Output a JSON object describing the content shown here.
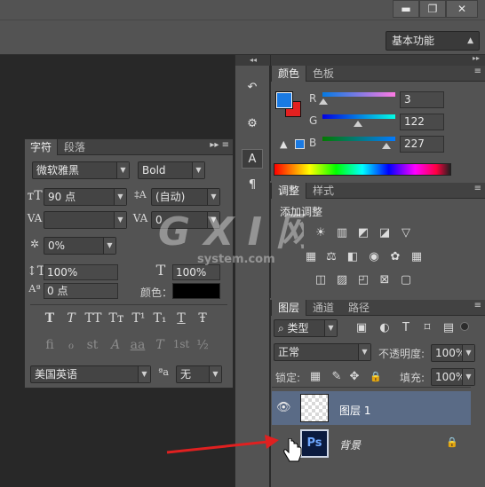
{
  "window": {
    "controls": [
      "minimize-icon",
      "restore-icon",
      "close-icon"
    ],
    "minimize_glyph": "▬",
    "restore_glyph": "❐",
    "close_glyph": "✕"
  },
  "options_bar": {
    "workspace": "基本功能"
  },
  "character_panel": {
    "tabs": [
      "字符",
      "段落"
    ],
    "font_family": "微软雅黑",
    "font_style": "Bold",
    "font_size": "90 点",
    "leading": "(自动)",
    "kerning": "",
    "tracking": "0",
    "tsume": "0%",
    "vertical_scale": "100%",
    "horizontal_scale": "100%",
    "baseline_shift": "0 点",
    "color_label": "颜色：",
    "text_color": "#000000",
    "style_buttons": [
      "T",
      "T",
      "TT",
      "Tт",
      "T¹",
      "T₁",
      "T",
      "Ŧ"
    ],
    "opentype_buttons": [
      "fi",
      "ℴ",
      "st",
      "A",
      "aa",
      "T",
      "1st",
      "½"
    ],
    "language": "美国英语",
    "antialias_glyph": "ªa",
    "antialias": "无"
  },
  "side_strip": {
    "collapse_glyph": "◂◂",
    "buttons": [
      "history-icon",
      "properties-icon",
      "character-icon",
      "paragraph-icon"
    ],
    "glyphs": [
      "↶",
      "⚙",
      "A",
      "¶"
    ]
  },
  "color_panel": {
    "tabs": [
      "颜色",
      "色板"
    ],
    "foreground": "#1a7ae3",
    "background": "#e32020",
    "channels": [
      {
        "label": "R",
        "value": "3"
      },
      {
        "label": "G",
        "value": "122"
      },
      {
        "label": "B",
        "value": "227"
      }
    ],
    "warning_glyph": "▲"
  },
  "adjustments_panel": {
    "tabs": [
      "调整",
      "样式"
    ],
    "title": "添加调整",
    "row1": [
      "☀",
      "▥",
      "◩",
      "◪",
      "▽"
    ],
    "row2": [
      "▦",
      "⚖",
      "◧",
      "◉",
      "✿",
      "▦"
    ],
    "row3": [
      "◫",
      "▨",
      "◰",
      "⊠",
      "▢"
    ]
  },
  "layers_panel": {
    "tabs": [
      "图层",
      "通道",
      "路径"
    ],
    "filter_label": "类型",
    "filter_icons": [
      "▣",
      "◐",
      "T",
      "⌑",
      "▤"
    ],
    "blend_mode": "正常",
    "opacity_label": "不透明度:",
    "opacity": "100%",
    "lock_label": "锁定:",
    "lock_icons": [
      "▦",
      "✎",
      "✥",
      "🔒"
    ],
    "fill_label": "填充:",
    "fill": "100%",
    "layers": [
      {
        "name": "图层 1",
        "visible": true,
        "selected": true
      },
      {
        "name": "背景",
        "visible": false,
        "selected": false,
        "locked": true,
        "thumb_text": "Ps"
      }
    ]
  },
  "watermark": {
    "text": "G X I 网",
    "sub": "system.com"
  },
  "menu_glyph": "▸▸ ≡"
}
